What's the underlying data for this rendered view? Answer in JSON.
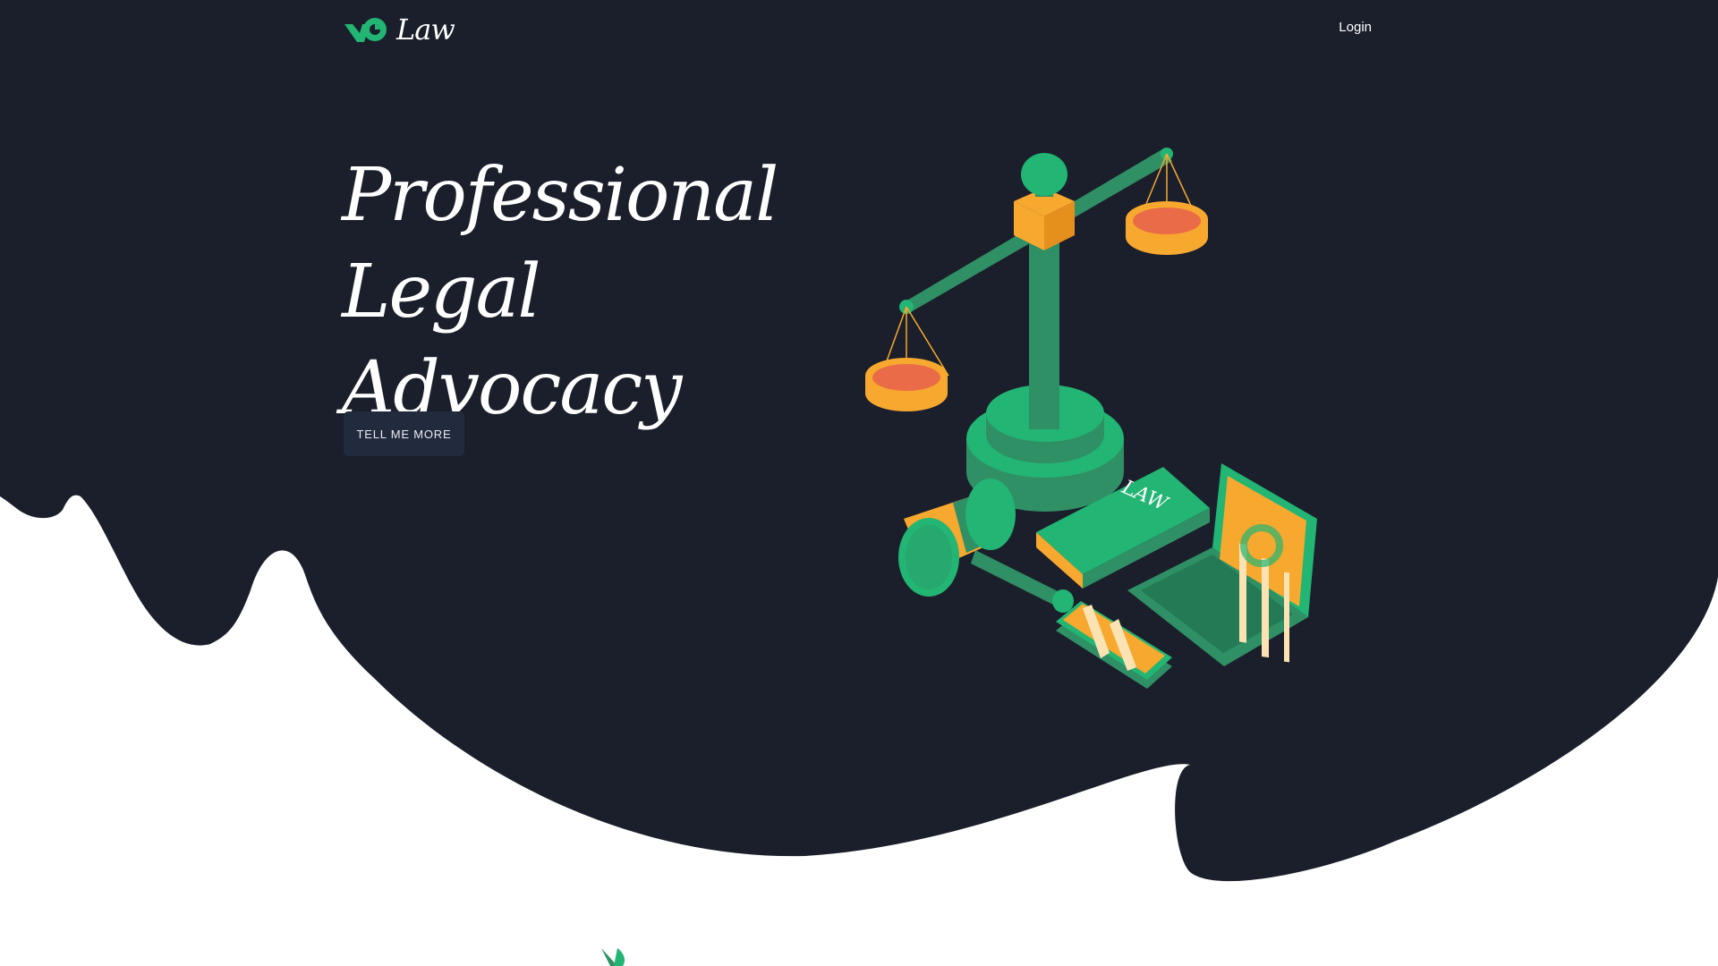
{
  "nav": {
    "logo_text": "Law",
    "login_label": "Login"
  },
  "hero": {
    "title": "Professional Legal Advocacy",
    "cta_label": "TELL ME MORE"
  },
  "illustration": {
    "book_label": "LAW"
  },
  "colors": {
    "background_dark": "#1b1f2b",
    "accent_green": "#22b573",
    "accent_dark_green": "#2f8f65",
    "accent_orange": "#f7a82f",
    "accent_red": "#ea6b47",
    "button_bg": "#222a3d",
    "text_light": "#ffffff"
  }
}
